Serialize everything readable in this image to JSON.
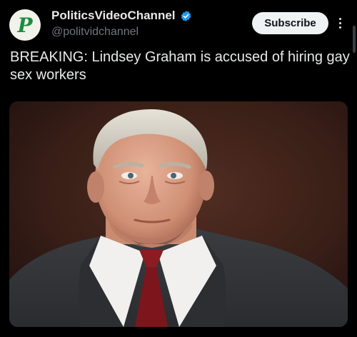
{
  "account": {
    "display_name": "PoliticsVideoChannel",
    "handle": "@politvidchannel",
    "avatar_letter": "P",
    "verified": true
  },
  "actions": {
    "subscribe_label": "Subscribe",
    "more_icon": "more-vertical-icon"
  },
  "post": {
    "text": "BREAKING: Lindsey Graham is accused of hiring gay sex workers"
  },
  "media": {
    "description_icon": "video-thumbnail"
  },
  "colors": {
    "background": "#000000",
    "text_primary": "#e7e9ea",
    "text_secondary": "#71767b",
    "verified_blue": "#1d9bf0",
    "avatar_green": "#1f8a43",
    "button_bg": "#eff3f4"
  }
}
